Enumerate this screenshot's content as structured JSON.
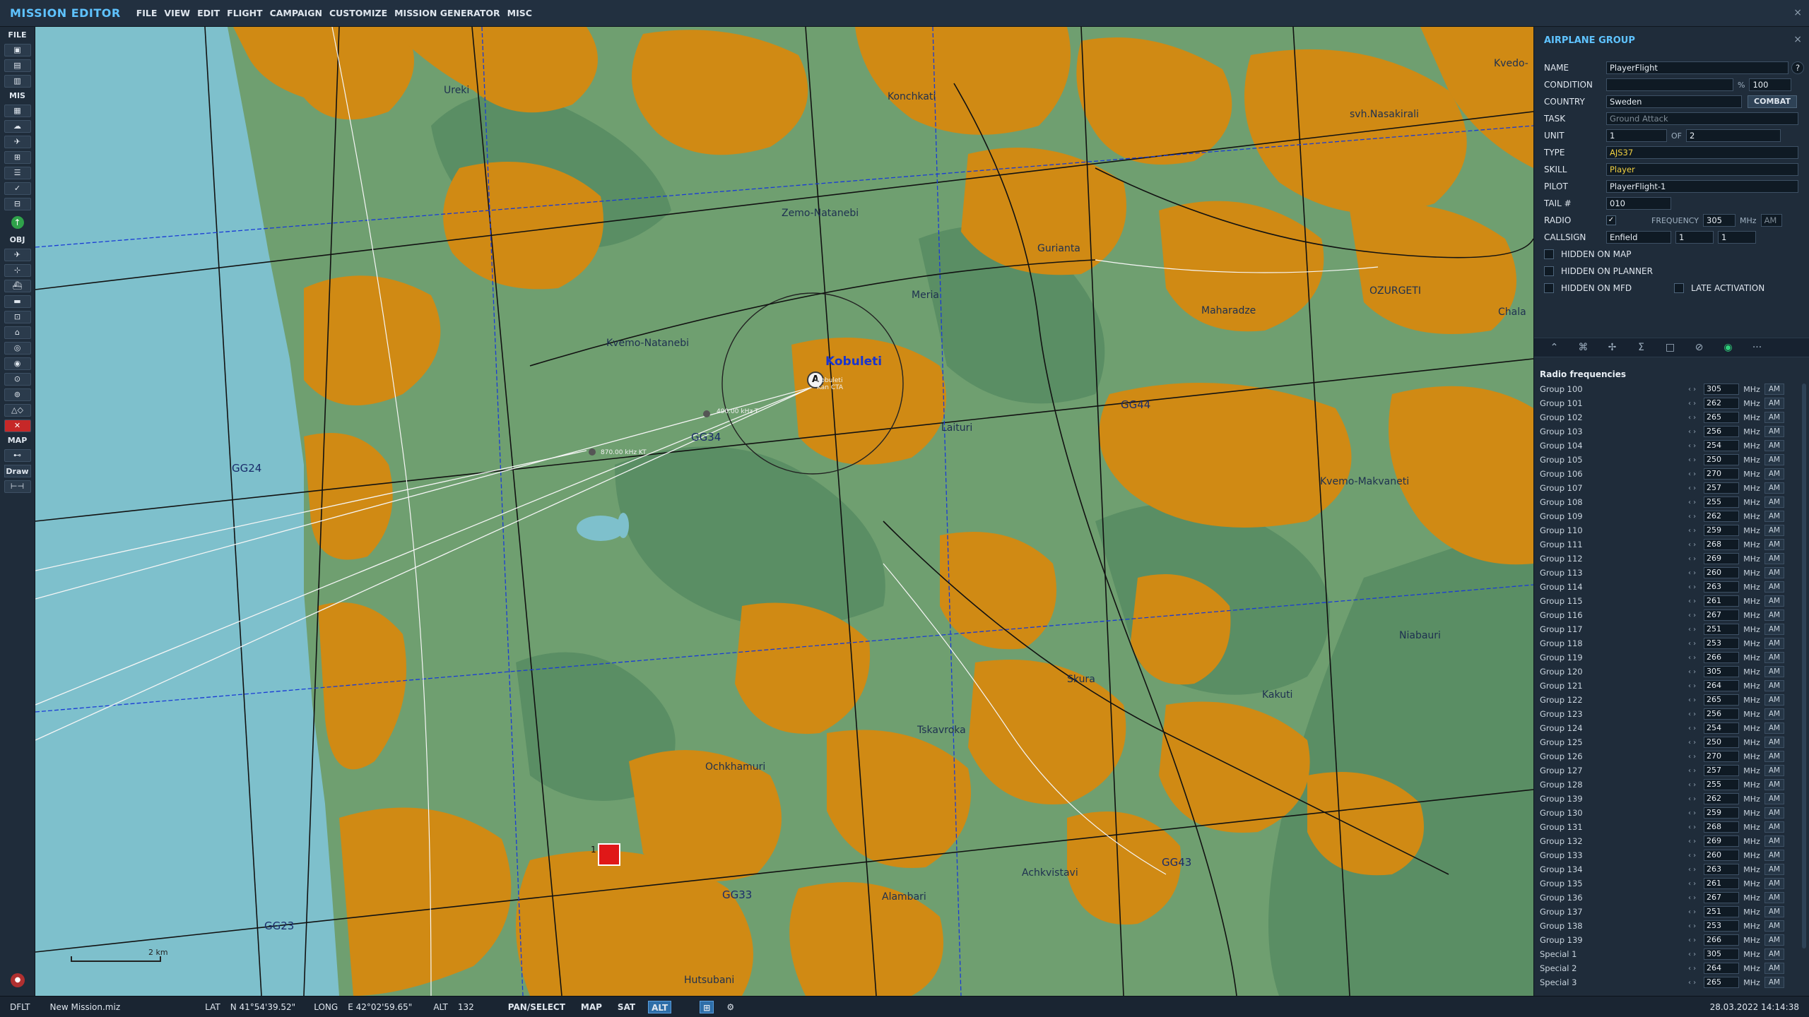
{
  "app": {
    "title": "MISSION EDITOR",
    "close": "×"
  },
  "menu": [
    "FILE",
    "VIEW",
    "EDIT",
    "FLIGHT",
    "CAMPAIGN",
    "CUSTOMIZE",
    "MISSION GENERATOR",
    "MISC"
  ],
  "toolbar": {
    "file": "FILE",
    "mis": "MIS",
    "obj": "OBJ",
    "map": "MAP",
    "draw": "Draw"
  },
  "map": {
    "towns": [
      {
        "name": "Ureki"
      },
      {
        "name": "Konchkati"
      },
      {
        "name": "Zemo-Natanebi"
      },
      {
        "name": "Gurianta"
      },
      {
        "name": "Meria"
      },
      {
        "name": "Kvemo-Natanebi"
      },
      {
        "name": "Maharadze"
      },
      {
        "name": "OZURGETI"
      },
      {
        "name": "Chala"
      },
      {
        "name": "svh.Nasakirali"
      },
      {
        "name": "Kvedo-"
      },
      {
        "name": "Laituri"
      },
      {
        "name": "Kvemo-Makvaneti"
      },
      {
        "name": "Niabauri"
      },
      {
        "name": "Kakuti"
      },
      {
        "name": "Skura"
      },
      {
        "name": "Tskavroka"
      },
      {
        "name": "Ochkhamuri"
      },
      {
        "name": "Alambari"
      },
      {
        "name": "Achkvistavi"
      },
      {
        "name": "Hutsubani"
      }
    ],
    "grid_labels": [
      "GG24",
      "GG34",
      "GG44",
      "GG33",
      "GG43",
      "GG23"
    ],
    "airfield": {
      "name": "Kobuleti",
      "marker": "A"
    },
    "nav_labels": [
      "870.00 kHz KT",
      "490.00 kHz T",
      "Kobuleti",
      "Kan CTA"
    ],
    "scale": "2 km",
    "unit_number": "1"
  },
  "panel": {
    "title": "AIRPLANE GROUP",
    "close": "×",
    "name_label": "NAME",
    "name_value": "PlayerFlight",
    "help": "?",
    "condition_label": "CONDITION",
    "condition_value": "",
    "condition_pct": "%",
    "condition_num": "100",
    "country_label": "COUNTRY",
    "country_value": "Sweden",
    "combat_button": "COMBAT",
    "task_label": "TASK",
    "task_value": "Ground Attack",
    "unit_label": "UNIT",
    "unit_value": "1",
    "unit_of": "OF",
    "unit_total": "2",
    "type_label": "TYPE",
    "type_value": "AJS37",
    "skill_label": "SKILL",
    "skill_value": "Player",
    "pilot_label": "PILOT",
    "pilot_value": "PlayerFlight-1",
    "tail_label": "TAIL #",
    "tail_value": "010",
    "radio_label": "RADIO",
    "radio_checked": "✓",
    "frequency_label": "FREQUENCY",
    "frequency_value": "305",
    "frequency_unit": "MHz",
    "frequency_mod": "AM",
    "callsign_label": "CALLSIGN",
    "callsign_value": "Enfield",
    "callsign_n1": "1",
    "callsign_n2": "1",
    "hidden_map": "HIDDEN ON MAP",
    "hidden_planner": "HIDDEN ON PLANNER",
    "hidden_mfd": "HIDDEN ON MFD",
    "late_activation": "LATE ACTIVATION"
  },
  "tabs": [
    "route-icon",
    "waypoint-icon",
    "targets-icon",
    "payload-icon",
    "fuel-icon",
    "failures-icon",
    "radio-icon",
    "more-icon"
  ],
  "radio": {
    "title": "Radio frequencies",
    "unit": "MHz",
    "rows": [
      {
        "name": "Group 100",
        "freq": "305",
        "mod": "AM"
      },
      {
        "name": "Group 101",
        "freq": "262",
        "mod": "AM"
      },
      {
        "name": "Group 102",
        "freq": "265",
        "mod": "AM"
      },
      {
        "name": "Group 103",
        "freq": "256",
        "mod": "AM"
      },
      {
        "name": "Group 104",
        "freq": "254",
        "mod": "AM"
      },
      {
        "name": "Group 105",
        "freq": "250",
        "mod": "AM"
      },
      {
        "name": "Group 106",
        "freq": "270",
        "mod": "AM"
      },
      {
        "name": "Group 107",
        "freq": "257",
        "mod": "AM"
      },
      {
        "name": "Group 108",
        "freq": "255",
        "mod": "AM"
      },
      {
        "name": "Group 109",
        "freq": "262",
        "mod": "AM"
      },
      {
        "name": "Group 110",
        "freq": "259",
        "mod": "AM"
      },
      {
        "name": "Group 111",
        "freq": "268",
        "mod": "AM"
      },
      {
        "name": "Group 112",
        "freq": "269",
        "mod": "AM"
      },
      {
        "name": "Group 113",
        "freq": "260",
        "mod": "AM"
      },
      {
        "name": "Group 114",
        "freq": "263",
        "mod": "AM"
      },
      {
        "name": "Group 115",
        "freq": "261",
        "mod": "AM"
      },
      {
        "name": "Group 116",
        "freq": "267",
        "mod": "AM"
      },
      {
        "name": "Group 117",
        "freq": "251",
        "mod": "AM"
      },
      {
        "name": "Group 118",
        "freq": "253",
        "mod": "AM"
      },
      {
        "name": "Group 119",
        "freq": "266",
        "mod": "AM"
      },
      {
        "name": "Group 120",
        "freq": "305",
        "mod": "AM"
      },
      {
        "name": "Group 121",
        "freq": "264",
        "mod": "AM"
      },
      {
        "name": "Group 122",
        "freq": "265",
        "mod": "AM"
      },
      {
        "name": "Group 123",
        "freq": "256",
        "mod": "AM"
      },
      {
        "name": "Group 124",
        "freq": "254",
        "mod": "AM"
      },
      {
        "name": "Group 125",
        "freq": "250",
        "mod": "AM"
      },
      {
        "name": "Group 126",
        "freq": "270",
        "mod": "AM"
      },
      {
        "name": "Group 127",
        "freq": "257",
        "mod": "AM"
      },
      {
        "name": "Group 128",
        "freq": "255",
        "mod": "AM"
      },
      {
        "name": "Group 139",
        "freq": "262",
        "mod": "AM"
      },
      {
        "name": "Group 130",
        "freq": "259",
        "mod": "AM"
      },
      {
        "name": "Group 131",
        "freq": "268",
        "mod": "AM"
      },
      {
        "name": "Group 132",
        "freq": "269",
        "mod": "AM"
      },
      {
        "name": "Group 133",
        "freq": "260",
        "mod": "AM"
      },
      {
        "name": "Group 134",
        "freq": "263",
        "mod": "AM"
      },
      {
        "name": "Group 135",
        "freq": "261",
        "mod": "AM"
      },
      {
        "name": "Group 136",
        "freq": "267",
        "mod": "AM"
      },
      {
        "name": "Group 137",
        "freq": "251",
        "mod": "AM"
      },
      {
        "name": "Group 138",
        "freq": "253",
        "mod": "AM"
      },
      {
        "name": "Group 139",
        "freq": "266",
        "mod": "AM"
      },
      {
        "name": "Special 1",
        "freq": "305",
        "mod": "AM"
      },
      {
        "name": "Special 2",
        "freq": "264",
        "mod": "AM"
      },
      {
        "name": "Special 3",
        "freq": "265",
        "mod": "AM"
      }
    ]
  },
  "status": {
    "profile": "DFLT",
    "mission_file": "New Mission.miz",
    "lat_label": "LAT",
    "lat_value": "N 41°54'39.52\"",
    "long_label": "LONG",
    "long_value": "E 42°02'59.65\"",
    "alt_label": "ALT",
    "alt_value": "132",
    "modes": [
      "PAN/SELECT",
      "MAP",
      "SAT",
      "ALT"
    ],
    "active_mode": "ALT",
    "datetime": "28.03.2022 14:14:38"
  },
  "colors": {
    "accent": "#5fc3ff",
    "land": "#6f9f70",
    "forest": "#5a8e64",
    "urban": "#d08a14",
    "sea": "#7ec0cc",
    "unit": "#e01818"
  }
}
